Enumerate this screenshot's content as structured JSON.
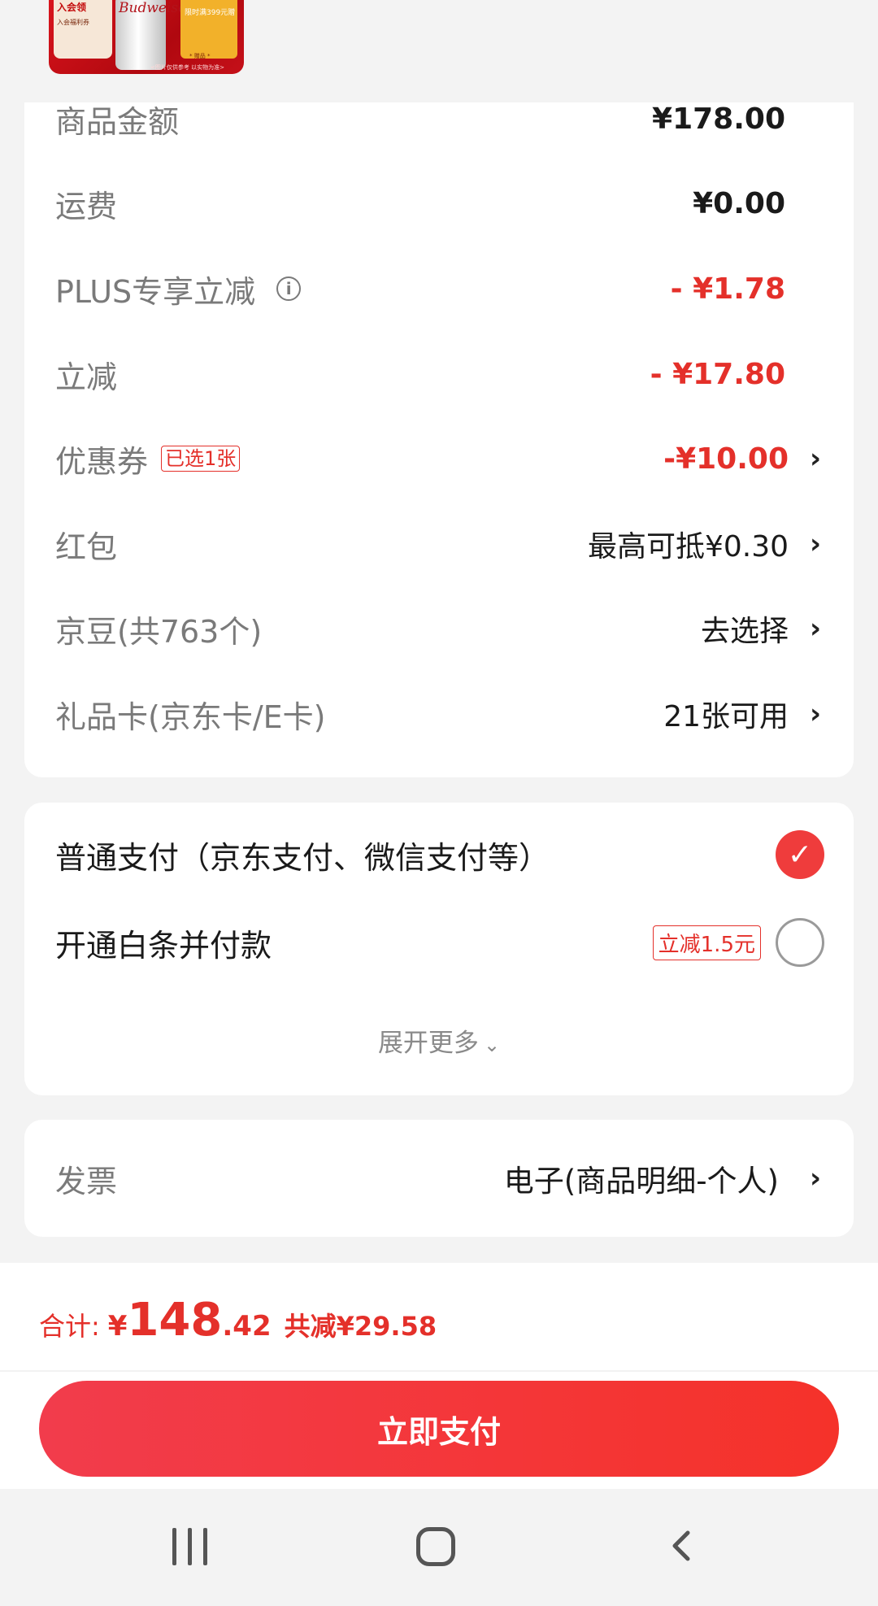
{
  "banner": {
    "can_text": "Budweiser",
    "left_card_title": "入会领",
    "left_card_sub": "入会福利券",
    "right_card_top": "限时满399元赠",
    "right_card_bottom": "* 赠品 *",
    "footer": "<图片仅供参考 以实物为准>"
  },
  "prices": {
    "rows": [
      {
        "label": "商品金额",
        "value": "¥178.00"
      },
      {
        "label": "运费",
        "value": "¥0.00"
      },
      {
        "label": "PLUS专享立减",
        "value": "- ¥1.78"
      },
      {
        "label": "立减",
        "value": "- ¥17.80"
      },
      {
        "label": "优惠券",
        "tag": "已选1张",
        "value": "-¥10.00"
      },
      {
        "label": "红包",
        "value": "最高可抵¥0.30"
      },
      {
        "label": "京豆(共763个)",
        "value": "去选择"
      },
      {
        "label": "礼品卡(京东卡/E卡)",
        "value": "21张可用"
      }
    ],
    "chevron": "›",
    "info_icon": "i"
  },
  "payment": {
    "option1": "普通支付（京东支付、微信支付等）",
    "option2": "开通白条并付款",
    "option2_tag": "立减1.5元",
    "check_glyph": "✓",
    "expand_label": "展开更多",
    "expand_chevron": "⌄"
  },
  "invoice": {
    "label": "发票",
    "value": "电子(商品明细-个人)"
  },
  "summary": {
    "total_label": "合计:",
    "currency": "¥",
    "total_integer": "148",
    "total_decimal": ".42",
    "saved": "共减¥29.58",
    "pay_button": "立即支付"
  },
  "colors": {
    "accent_red": "#e4302a",
    "button_start": "#f23c4c",
    "button_end": "#f5322a"
  },
  "icons": [
    "info-icon",
    "chevron-right-icon",
    "checkmark-icon",
    "chevron-down-icon",
    "recent-apps-icon",
    "home-icon",
    "back-icon"
  ]
}
